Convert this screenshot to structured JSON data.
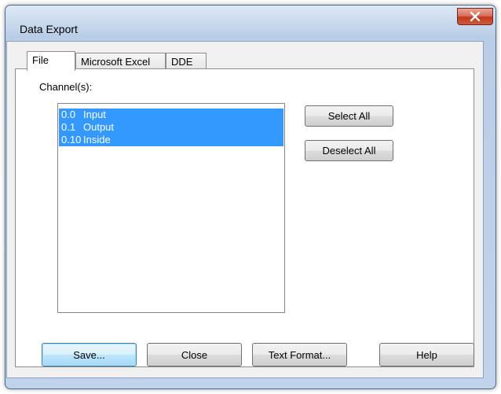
{
  "window": {
    "title": "Data Export",
    "close_glyph": "x"
  },
  "tabs": [
    {
      "label": "File",
      "active": true
    },
    {
      "label": "Microsoft Excel",
      "active": false
    },
    {
      "label": "DDE",
      "active": false
    }
  ],
  "channels": {
    "label": "Channel(s):",
    "items": [
      {
        "number": "0.0",
        "name": "Input",
        "selected": true
      },
      {
        "number": "0.1",
        "name": "Output",
        "selected": true
      },
      {
        "number": "0.10",
        "name": "Inside",
        "selected": true
      }
    ],
    "select_all_label": "Select All",
    "deselect_all_label": "Deselect All"
  },
  "footer": {
    "save_label": "Save...",
    "close_label": "Close",
    "text_format_label": "Text Format...",
    "help_label": "Help"
  },
  "colors": {
    "selection": "#3399ff",
    "close_button": "#c0391f"
  },
  "icons": {
    "close": "close-icon"
  }
}
